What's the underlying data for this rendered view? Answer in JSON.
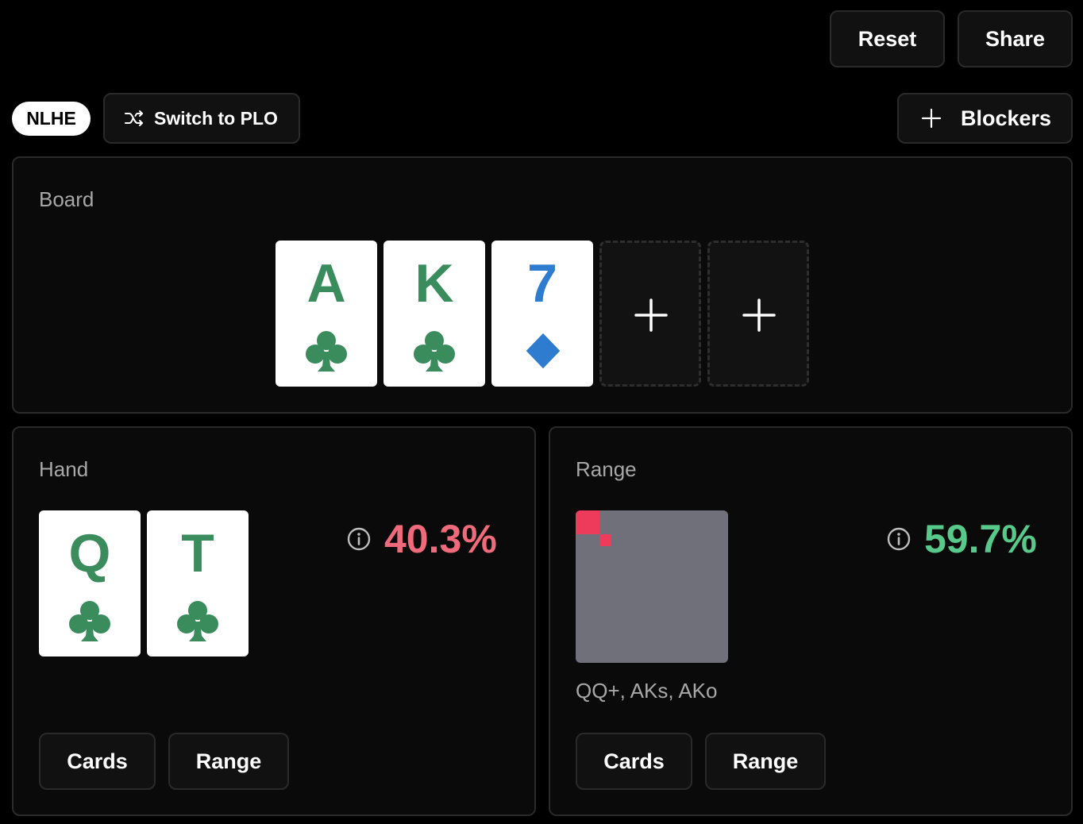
{
  "header": {
    "reset_label": "Reset",
    "share_label": "Share"
  },
  "mode": {
    "current": "NLHE",
    "switch_label": "Switch to PLO"
  },
  "blockers_label": "Blockers",
  "board": {
    "label": "Board",
    "cards": [
      {
        "rank": "A",
        "suit": "clubs"
      },
      {
        "rank": "K",
        "suit": "clubs"
      },
      {
        "rank": "7",
        "suit": "diamonds"
      }
    ],
    "empty_slots": 2
  },
  "hand": {
    "label": "Hand",
    "cards": [
      {
        "rank": "Q",
        "suit": "clubs"
      },
      {
        "rank": "T",
        "suit": "clubs"
      }
    ],
    "equity": "40.3%",
    "cards_button": "Cards",
    "range_button": "Range"
  },
  "range": {
    "label": "Range",
    "equity": "59.7%",
    "summary": "QQ+, AKs, AKo",
    "cards_button": "Cards",
    "range_button": "Range"
  },
  "colors": {
    "clubs": "#3a8c5c",
    "diamonds": "#2e7ccf",
    "hand_equity": "#ef6b7b",
    "range_equity": "#58c98a",
    "range_highlight": "#ee3b5c",
    "range_grid": "#6f7079"
  },
  "icons": {
    "switch": "shuffle-icon",
    "add": "plus-icon",
    "info": "info-icon"
  }
}
